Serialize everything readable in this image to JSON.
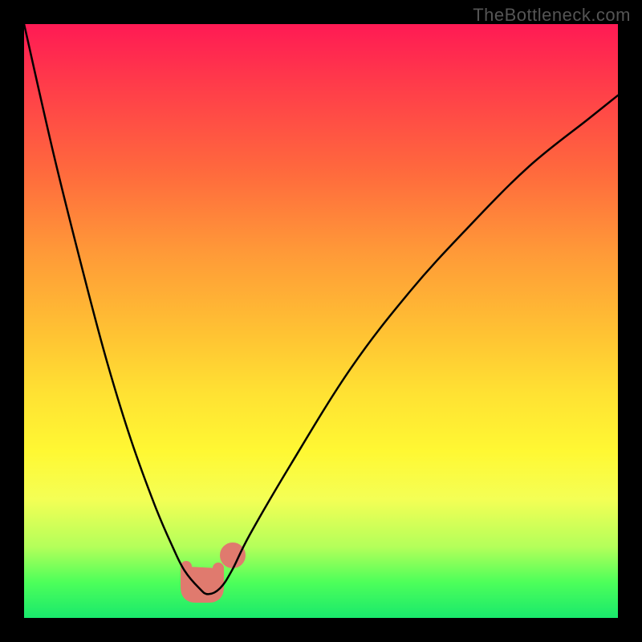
{
  "watermark": "TheBottleneck.com",
  "chart_data": {
    "type": "line",
    "title": "",
    "xlabel": "",
    "ylabel": "",
    "xlim": [
      0,
      100
    ],
    "ylim": [
      0,
      100
    ],
    "grid": false,
    "legend": false,
    "series": [
      {
        "name": "curve",
        "x": [
          0,
          5,
          10,
          14,
          18,
          22,
          25,
          27,
          29.5,
          31,
          33,
          35,
          38,
          45,
          55,
          65,
          75,
          85,
          95,
          100
        ],
        "y": [
          100,
          78,
          58,
          43,
          30,
          19,
          12,
          8,
          5,
          4,
          5,
          8,
          14,
          26,
          42,
          55,
          66,
          76,
          84,
          88
        ]
      }
    ],
    "highlight_region": {
      "x_range": [
        26,
        35
      ],
      "note": "pink rounded marker near minimum"
    },
    "background_gradient": {
      "orientation": "vertical",
      "stops": [
        {
          "pos": 0.0,
          "color": "#ff1a54"
        },
        {
          "pos": 0.25,
          "color": "#ff6a3d"
        },
        {
          "pos": 0.52,
          "color": "#ffc233"
        },
        {
          "pos": 0.72,
          "color": "#fff833"
        },
        {
          "pos": 0.94,
          "color": "#4dff5a"
        },
        {
          "pos": 1.0,
          "color": "#19e96c"
        }
      ]
    }
  }
}
